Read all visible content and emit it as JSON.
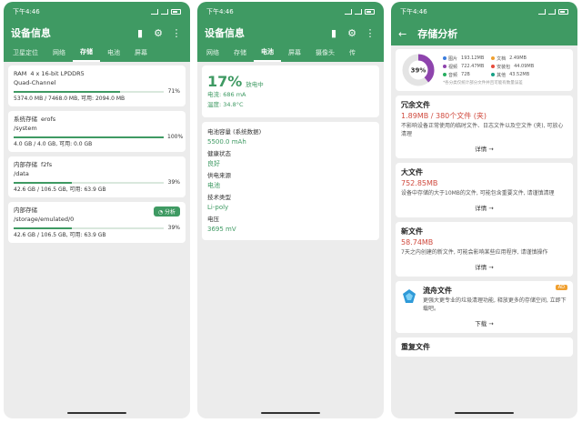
{
  "status_time": "下午4:46",
  "colors": {
    "accent": "#3f9a63",
    "value_red": "#d04a3e"
  },
  "icons": {
    "battery": "battery-icon",
    "settings": "gear-icon",
    "more": "more-vertical-icon",
    "back": "arrow-left-icon",
    "pie": "pie-chart-icon"
  },
  "screen1": {
    "title": "设备信息",
    "tabs": [
      "卫星定位",
      "网络",
      "存储",
      "电池",
      "屏幕"
    ],
    "active_tab": "存储",
    "ram": {
      "label": "RAM",
      "type": "4 x 16-bit LPDDR5",
      "channel": "Quad-Channel",
      "percent": "71%",
      "fraction": 0.71,
      "detail": "5374.0 MB / 7468.0 MB, 可用: 2094.0 MB"
    },
    "system": {
      "label": "系统存储",
      "fs": "erofs",
      "path": "/system",
      "percent": "100%",
      "fraction": 1.0,
      "detail": "4.0 GB / 4.0 GB, 可用: 0.0 GB"
    },
    "internal": {
      "label": "内部存储",
      "fs": "f2fs",
      "path": "/data",
      "percent": "39%",
      "fraction": 0.39,
      "detail": "42.6 GB / 106.5 GB, 可用: 63.9 GB"
    },
    "internal2": {
      "label": "内部存储",
      "path": "/storage/emulated/0",
      "percent": "39%",
      "fraction": 0.39,
      "detail": "42.6 GB / 106.5 GB, 可用: 63.9 GB",
      "analyze_button": "分析"
    }
  },
  "screen2": {
    "title": "设备信息",
    "tabs": [
      "网络",
      "存储",
      "电池",
      "屏幕",
      "摄像头",
      "传"
    ],
    "active_tab": "电池",
    "battery_percent": "17%",
    "charging": "放电中",
    "current": "电流: 686 mA",
    "temperature": "温度: 34.8°C",
    "capacity_label": "电池容量 (系统数据)",
    "capacity_value": "5500.0 mAh",
    "health_label": "健康状态",
    "health_value": "良好",
    "power_label": "供电来源",
    "power_value": "电池",
    "tech_label": "技术类型",
    "tech_value": "Li-poly",
    "voltage_label": "电压",
    "voltage_value": "3695 mV"
  },
  "screen3": {
    "title": "存储分析",
    "donut_percent": "39%",
    "donut_fraction": 0.39,
    "legend": [
      {
        "name": "图片",
        "value": "193.12MB",
        "color": "#3b7ddd"
      },
      {
        "name": "文档",
        "value": "2.49MB",
        "color": "#f0a030"
      },
      {
        "name": "视频",
        "value": "722.47MB",
        "color": "#8e44ad"
      },
      {
        "name": "安装包",
        "value": "44.09MB",
        "color": "#e74c3c"
      },
      {
        "name": "音频",
        "value": "72B",
        "color": "#27ae60"
      },
      {
        "name": "其他",
        "value": "43.52MB",
        "color": "#16a085"
      }
    ],
    "hint": "*各分类仅统计部分文件并且可能有数量误差",
    "cards": [
      {
        "title": "冗余文件",
        "value": "1.89MB / 380个文件 (夹)",
        "desc": "不影响设备正常使用的临时文件、日志文件以及空文件 (夹), 可放心清理",
        "link": "详情 →"
      },
      {
        "title": "大文件",
        "value": "752.85MB",
        "desc": "设备中存储的大于10MB的文件, 可能包含重要文件, 请谨慎清理",
        "link": "详情 →"
      },
      {
        "title": "新文件",
        "value": "58.74MB",
        "desc": "7天之内创建的新文件, 可能会影响某些应用程序, 请谨慎操作",
        "link": "详情 →"
      }
    ],
    "ad": {
      "title": "流舟文件",
      "badge": "AD",
      "desc": "更强大更专业的垃圾清理功能, 释放更多的存储空间, 立即下载吧。",
      "link": "下载 →"
    },
    "dup": {
      "title": "重复文件"
    }
  }
}
